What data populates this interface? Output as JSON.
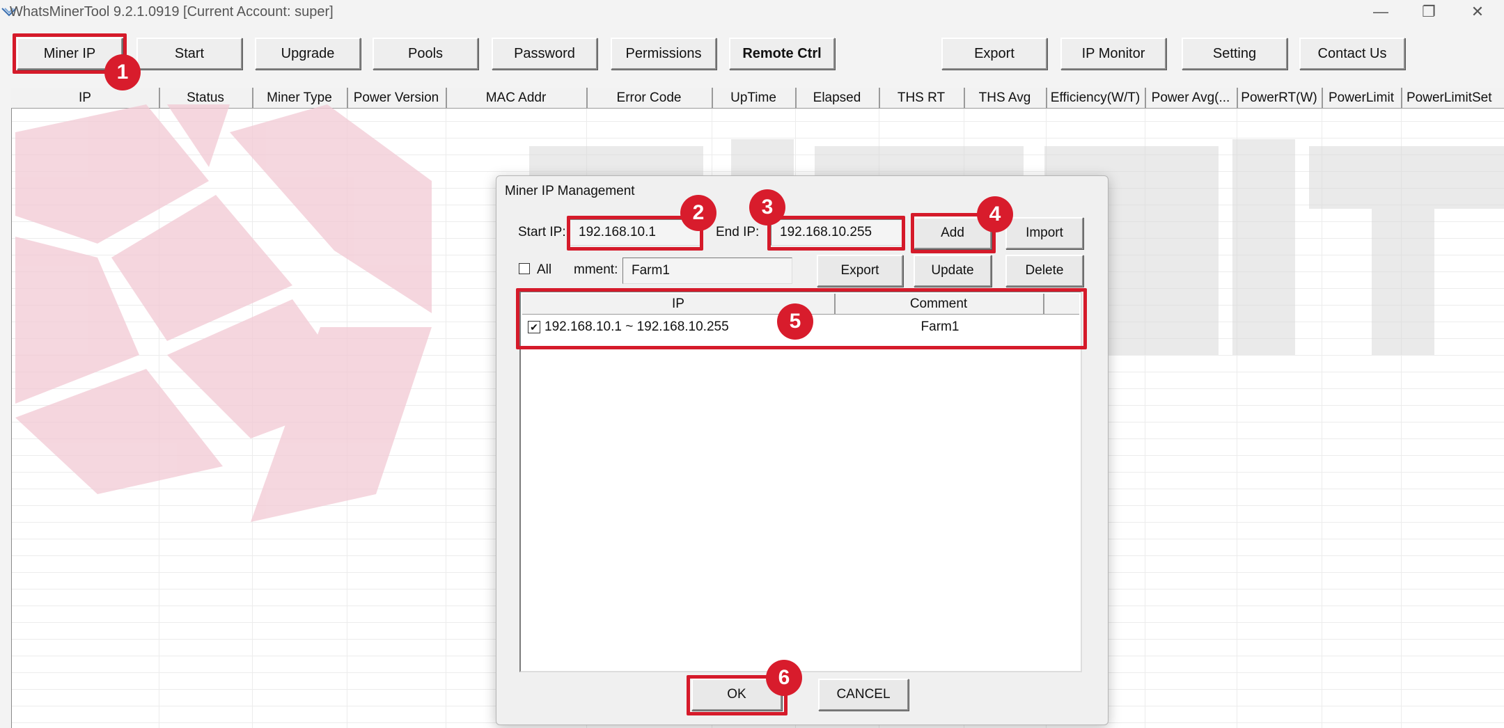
{
  "window": {
    "title": "WhatsMinerTool 9.2.1.0919 [Current Account: super]",
    "controls": {
      "minimize": "—",
      "restore": "❐",
      "close": "✕"
    }
  },
  "toolbar": {
    "miner_ip": "Miner IP",
    "start": "Start",
    "upgrade": "Upgrade",
    "pools": "Pools",
    "password": "Password",
    "permissions": "Permissions",
    "remote_ctrl": "Remote Ctrl",
    "export": "Export",
    "ip_monitor": "IP Monitor",
    "setting": "Setting",
    "contact_us": "Contact Us"
  },
  "grid": {
    "columns": [
      "IP",
      "Status",
      "Miner Type",
      "Power Version",
      "MAC Addr",
      "Error Code",
      "UpTime",
      "Elapsed",
      "THS RT",
      "THS Avg",
      "Efficiency(W/T)",
      "Power Avg(...",
      "PowerRT(W)",
      "PowerLimit",
      "PowerLimitSet"
    ]
  },
  "watermark": {
    "text": "BiXBiT",
    "color": "#f2c9d4"
  },
  "dialog": {
    "title": "Miner IP Management",
    "start_ip_label": "Start IP:",
    "start_ip_value": "192.168.10.1",
    "end_ip_label": "End IP:",
    "end_ip_value": "192.168.10.255",
    "add_button": "Add",
    "import_button": "Import",
    "all_label": "All",
    "all_checked": false,
    "comment_label": "mment:",
    "comment_value": "Farm1",
    "export_button": "Export",
    "update_button": "Update",
    "delete_button": "Delete",
    "list_columns": [
      "IP",
      "Comment"
    ],
    "list_rows": [
      {
        "checked": true,
        "ip": "192.168.10.1 ~ 192.168.10.255",
        "comment": "Farm1"
      }
    ],
    "ok_button": "OK",
    "cancel_button": "CANCEL"
  },
  "annotations": {
    "color": "#d51a2a",
    "steps": [
      "1",
      "2",
      "3",
      "4",
      "5",
      "6"
    ]
  }
}
